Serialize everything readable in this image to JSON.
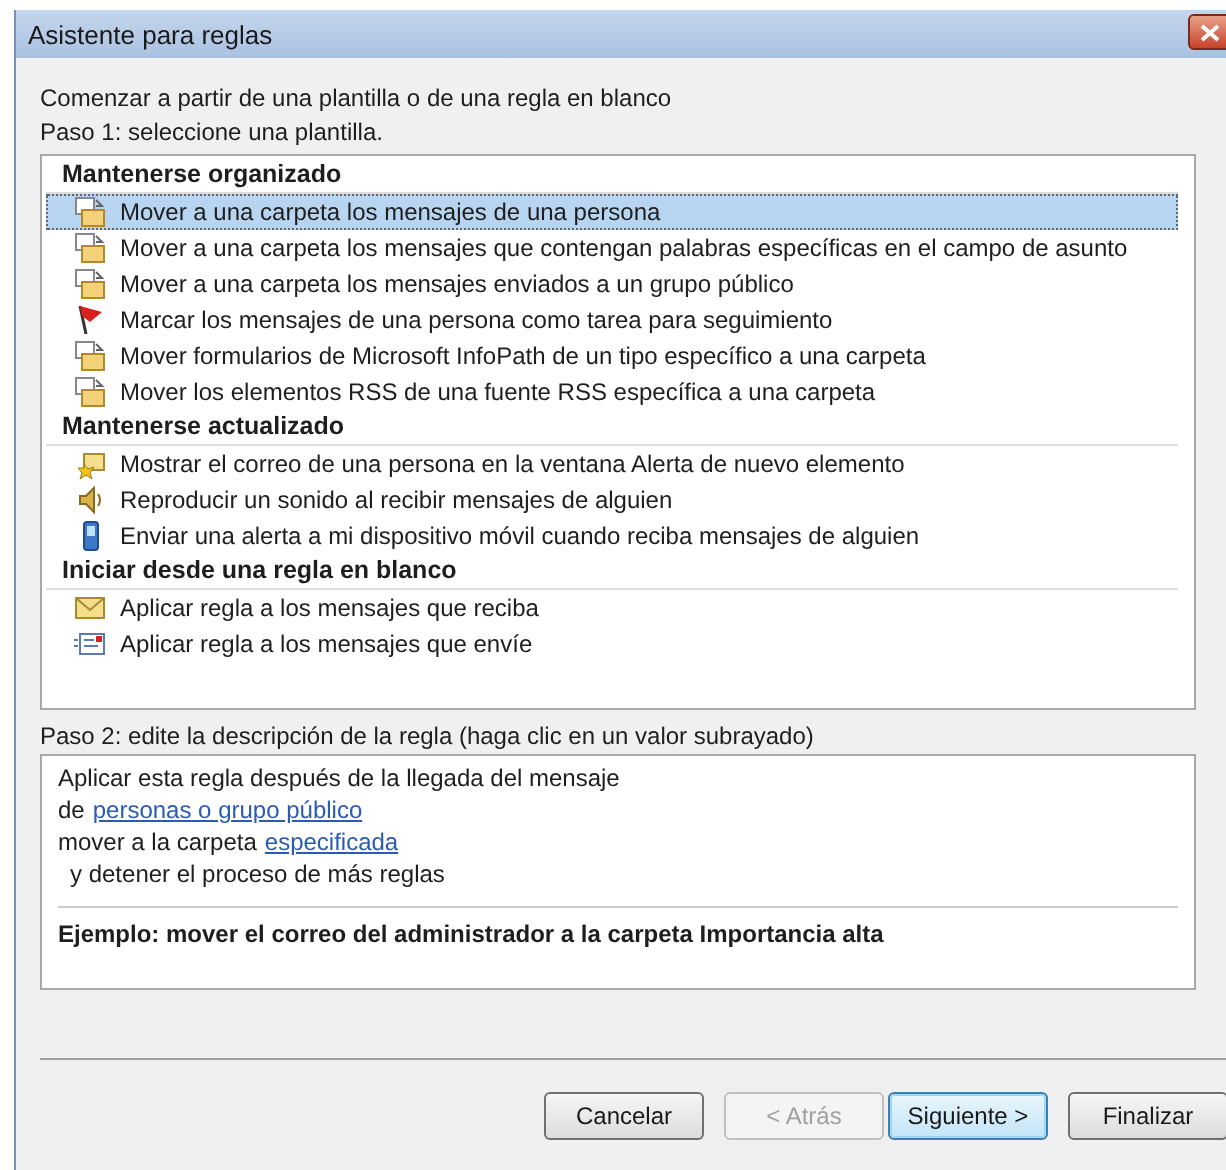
{
  "window": {
    "title": "Asistente para reglas"
  },
  "intro": "Comenzar a partir de una plantilla o de una regla en blanco",
  "step1": "Paso 1: seleccione una plantilla.",
  "groups": [
    {
      "title": "Mantenerse organizado",
      "items": [
        {
          "kind": "folder",
          "label": "Mover a una carpeta los mensajes de una persona",
          "selected": true
        },
        {
          "kind": "folder",
          "label": "Mover a una carpeta los mensajes que contengan palabras específicas en el campo de asunto",
          "selected": false
        },
        {
          "kind": "folder",
          "label": "Mover a una carpeta los mensajes enviados a un grupo público",
          "selected": false
        },
        {
          "kind": "flag",
          "label": "Marcar los mensajes de una persona como tarea para seguimiento",
          "selected": false
        },
        {
          "kind": "folder",
          "label": "Mover formularios de Microsoft InfoPath de un tipo específico a una carpeta",
          "selected": false
        },
        {
          "kind": "folder",
          "label": "Mover los elementos RSS de una fuente RSS específica a una carpeta",
          "selected": false
        }
      ]
    },
    {
      "title": "Mantenerse actualizado",
      "items": [
        {
          "kind": "alert",
          "label": "Mostrar el correo de una persona en la ventana Alerta de nuevo elemento",
          "selected": false
        },
        {
          "kind": "sound",
          "label": "Reproducir un sonido al recibir mensajes de alguien",
          "selected": false
        },
        {
          "kind": "mobile",
          "label": "Enviar una alerta a mi dispositivo móvil cuando reciba mensajes de alguien",
          "selected": false
        }
      ]
    },
    {
      "title": "Iniciar desde una regla en blanco",
      "items": [
        {
          "kind": "mail_in",
          "label": "Aplicar regla a los mensajes que reciba",
          "selected": false
        },
        {
          "kind": "mail_out",
          "label": "Aplicar regla a los mensajes que envíe",
          "selected": false
        }
      ]
    }
  ],
  "step2": "Paso 2: edite la descripción de la regla (haga clic en un valor subrayado)",
  "description": [
    {
      "indent": false,
      "parts": [
        {
          "text": "Aplicar esta regla después de la llegada del mensaje",
          "link": false
        }
      ]
    },
    {
      "indent": false,
      "parts": [
        {
          "text": "de",
          "link": false
        },
        {
          "text": "personas o grupo público",
          "link": true
        }
      ]
    },
    {
      "indent": false,
      "parts": [
        {
          "text": "mover a la carpeta",
          "link": false
        },
        {
          "text": "especificada",
          "link": true
        }
      ]
    },
    {
      "indent": true,
      "parts": [
        {
          "text": "y detener el proceso de más reglas",
          "link": false
        }
      ]
    }
  ],
  "example": "Ejemplo: mover el correo del administrador a la carpeta Importancia alta",
  "buttons": [
    {
      "label": "Cancelar",
      "disabled": false,
      "default": false
    },
    {
      "label": "< Atrás",
      "disabled": true,
      "default": false
    },
    {
      "label": "Siguiente >",
      "disabled": false,
      "default": true
    },
    {
      "label": "Finalizar",
      "disabled": false,
      "default": false
    }
  ]
}
